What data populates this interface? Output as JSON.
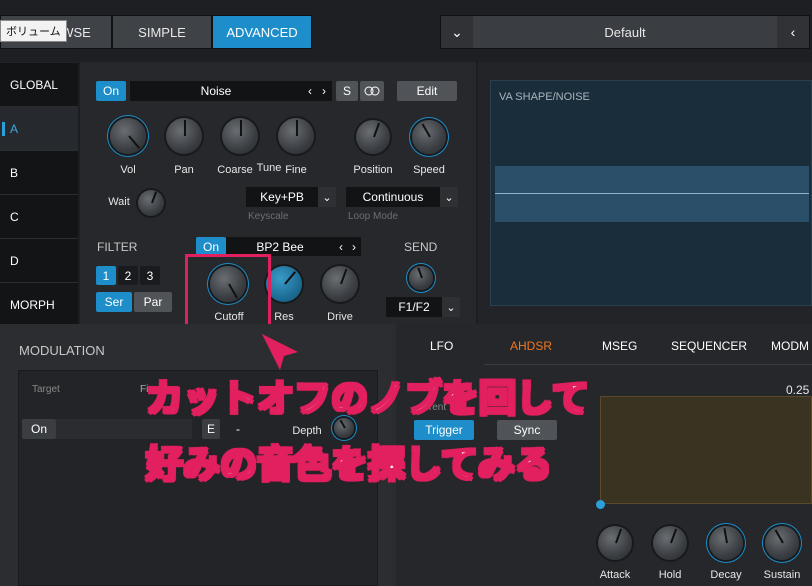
{
  "tooltip": "ボリューム",
  "topbar": {
    "tab_browse": "WSE",
    "tab_simple": "SIMPLE",
    "tab_advanced": "ADVANCED",
    "preset_name": "Default",
    "prev_arrow": "‹",
    "dropdown_arrow": "⌄"
  },
  "sidebar": {
    "items": [
      "GLOBAL",
      "A",
      "B",
      "C",
      "D",
      "MORPH"
    ],
    "selected": "A"
  },
  "osc": {
    "on_label": "On",
    "source": "Noise",
    "nav_prev": "‹",
    "nav_next": "›",
    "solo": "S",
    "edit": "Edit"
  },
  "knobs": {
    "vol": "Vol",
    "pan": "Pan",
    "coarse": "Coarse",
    "tune": "Tune",
    "fine": "Fine",
    "position": "Position",
    "speed": "Speed",
    "wait": "Wait"
  },
  "keyscale": {
    "value": "Key+PB",
    "label": "Keyscale"
  },
  "loopmode": {
    "value": "Continuous",
    "label": "Loop Mode"
  },
  "filter": {
    "title": "FILTER",
    "on_label": "On",
    "type": "BP2 Bee",
    "nums": [
      "1",
      "2",
      "3"
    ],
    "ser": "Ser",
    "par": "Par",
    "cutoff": "Cutoff",
    "res": "Res",
    "drive": "Drive"
  },
  "send": {
    "title": "SEND",
    "value": "F1/F2"
  },
  "display": {
    "title": "VA SHAPE/NOISE"
  },
  "modulation": {
    "title": "MODULATION",
    "target_header": "Target",
    "source_header": "Fi",
    "on_label": "On",
    "e_label": "E",
    "dash": "-",
    "depth": "Depth"
  },
  "env": {
    "tabs": [
      "LFO",
      "AHDSR",
      "MSEG",
      "SEQUENCER",
      "MODM"
    ],
    "active_tab": "AHDSR",
    "value": "0.25",
    "current": "urrent",
    "trigger": "Trigger",
    "sync": "Sync",
    "knobs": [
      "Attack",
      "Hold",
      "Decay",
      "Sustain"
    ]
  },
  "callout": {
    "line1": "カットオフのノブを回して",
    "line2": "好みの音色を探してみる"
  },
  "colors": {
    "accent": "#1d8ec9",
    "callout": "#e2205f",
    "envelope": "#f07820"
  }
}
